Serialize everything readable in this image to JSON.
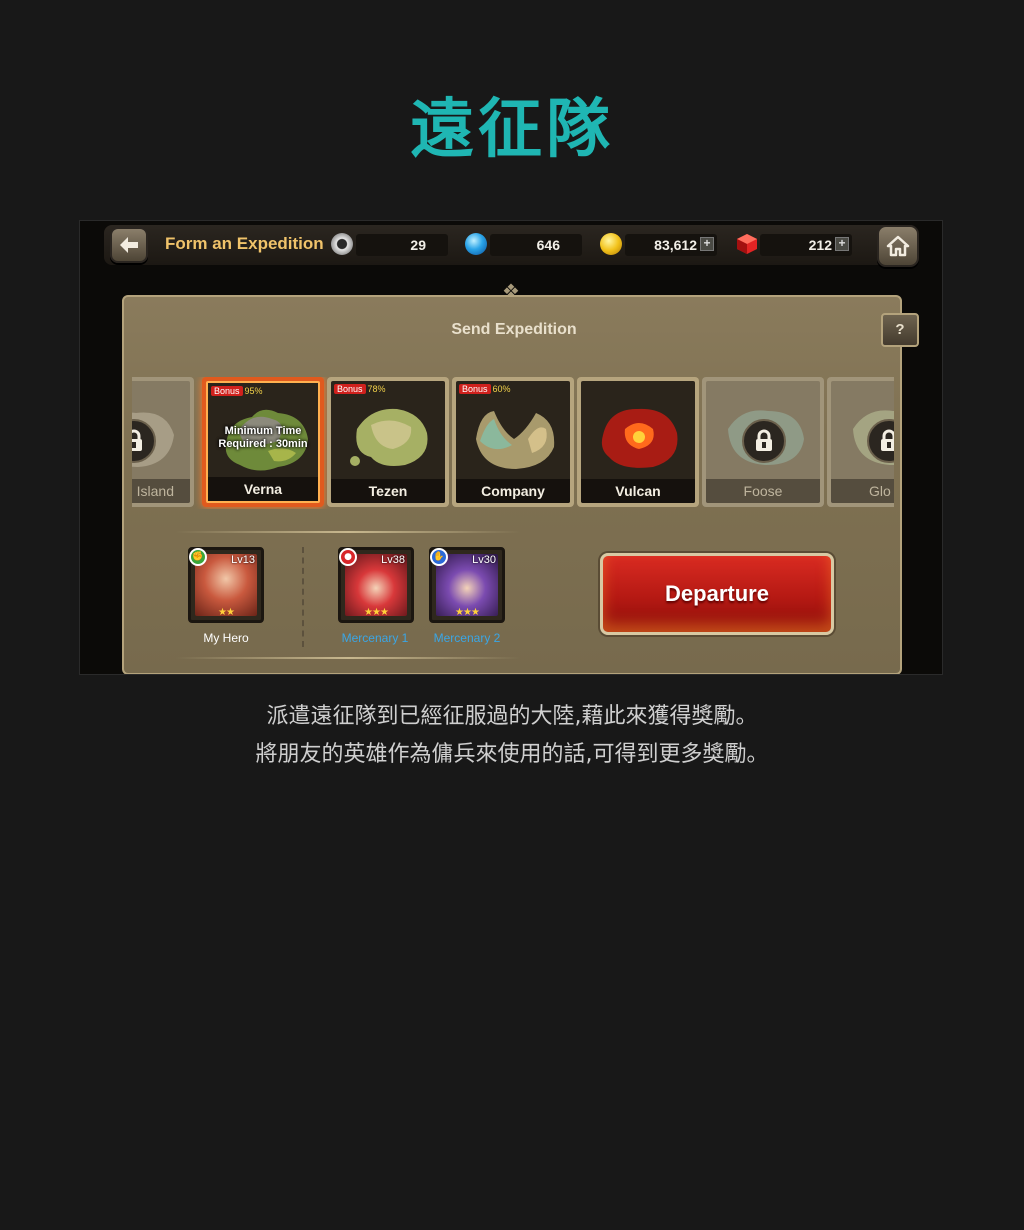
{
  "page": {
    "title": "遠征隊",
    "caption_lines": [
      "派遣遠征隊到已經征服過的大陸,藉此來獲得獎勵。",
      "將朋友的英雄作為傭兵來使用的話,可得到更多獎勵。"
    ]
  },
  "topbar": {
    "title": "Form an Expedition",
    "resources": [
      {
        "icon": "silver-ring-icon",
        "value": "29",
        "has_plus": false
      },
      {
        "icon": "blue-orb-icon",
        "value": "646",
        "has_plus": false
      },
      {
        "icon": "gold-coin-icon",
        "value": "83,612",
        "has_plus": true
      },
      {
        "icon": "red-gem-icon",
        "value": "212",
        "has_plus": true
      }
    ],
    "plus_label": "+"
  },
  "panel": {
    "title": "Send Expedition",
    "help_label": "?"
  },
  "maps": [
    {
      "name": "Island",
      "locked": true,
      "bonus": null
    },
    {
      "name": "Verna",
      "locked": false,
      "selected": true,
      "bonus_tag": "Bonus",
      "bonus_pct": "95%",
      "min_time_line1": "Minimum Time",
      "min_time_line2": "Required : 30min"
    },
    {
      "name": "Tezen",
      "locked": false,
      "bonus_tag": "Bonus",
      "bonus_pct": "78%"
    },
    {
      "name": "Company",
      "locked": false,
      "bonus_tag": "Bonus",
      "bonus_pct": "60%"
    },
    {
      "name": "Vulcan",
      "locked": false
    },
    {
      "name": "Foose",
      "locked": true
    },
    {
      "name": "Glo",
      "locked": true
    }
  ],
  "team": {
    "my_hero": {
      "label": "My Hero",
      "level": "Lv13",
      "stars": "★★"
    },
    "mercenaries": [
      {
        "label": "Mercenary 1",
        "level": "Lv38",
        "stars": "★★★"
      },
      {
        "label": "Mercenary 2",
        "level": "Lv30",
        "stars": "★★★"
      }
    ]
  },
  "departure_label": "Departure",
  "colors": {
    "title_teal": "#1fb6b3",
    "bar_title_gold": "#f0c36a",
    "mercenary_label_blue": "#3aa6e6",
    "departure_red": "#c41f18",
    "selected_orange": "#e05a1e"
  }
}
